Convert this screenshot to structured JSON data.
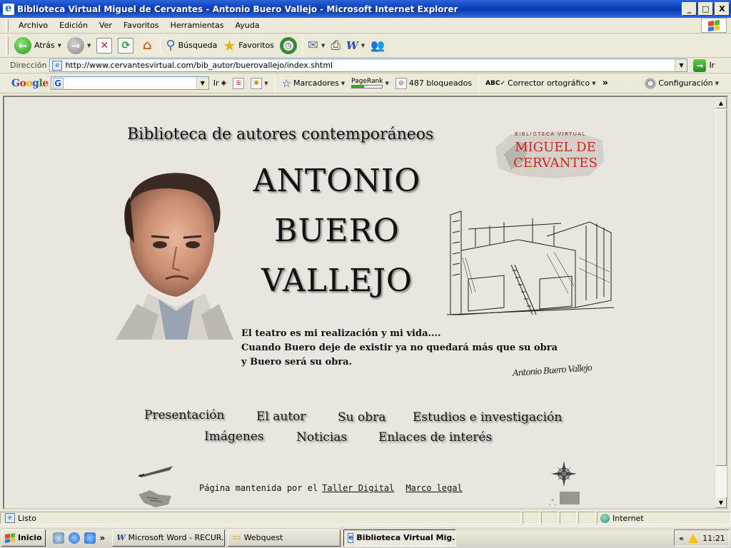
{
  "window": {
    "title": "Biblioteca Virtual Miguel de Cervantes - Antonio Buero Vallejo - Microsoft Internet Explorer",
    "minimize": "_",
    "maximize": "□",
    "close": "X"
  },
  "menu": {
    "items": [
      "Archivo",
      "Edición",
      "Ver",
      "Favoritos",
      "Herramientas",
      "Ayuda"
    ]
  },
  "toolbar": {
    "back_label": "Atrás",
    "search_label": "Búsqueda",
    "favorites_label": "Favoritos"
  },
  "address": {
    "label": "Dirección",
    "url": "http://www.cervantesvirtual.com/bib_autor/buerovallejo/index.shtml",
    "go_label": "Ir"
  },
  "google_bar": {
    "logo": [
      "G",
      "o",
      "o",
      "g",
      "l",
      "e"
    ],
    "go_label": "Ir",
    "bookmarks_label": "Marcadores",
    "pagerank_label": "PageRank",
    "pagerank_level": 0.4,
    "blocked_label": "487 bloqueados",
    "spell_label": "Corrector ortográfico",
    "more_label": "»",
    "settings_label": "Configuración"
  },
  "page": {
    "heading": "Biblioteca de autores contemporáneos",
    "name_lines": [
      "ANTONIO",
      "BUERO",
      "VALLEJO"
    ],
    "quote_lines": [
      "El teatro es mi realización y mi vida....",
      "Cuando Buero deje de existir ya no quedará más que su obra",
      "y Buero será su obra."
    ],
    "signature": "Antonio Buero Vallejo",
    "logo_top": "BIBLIOTECA VIRTUAL",
    "logo_line1": "MIGUEL DE",
    "logo_line2": "CERVANTES",
    "nav": {
      "presentacion": "Presentación",
      "autor": "El autor",
      "obra": "Su obra",
      "estudios": "Estudios e investigación",
      "imagenes": "Imágenes",
      "noticias": "Noticias",
      "enlaces": "Enlaces de interés"
    },
    "footer": {
      "text": "Página mantenida por el",
      "link1": "Taller Digital",
      "link2": "Marco legal"
    }
  },
  "status": {
    "text": "Listo",
    "zone": "Internet"
  },
  "taskbar": {
    "start": "Inicio",
    "more": "»",
    "tasks": [
      "Microsoft Word - RECUR...",
      "Webquest",
      "Biblioteca Virtual Mig..."
    ],
    "tray_more": "«",
    "clock": "11:21"
  },
  "colors": {
    "titlebar": "#0a3fb8",
    "page_bg": "#e9e5df",
    "logo_red": "#c8281e"
  }
}
